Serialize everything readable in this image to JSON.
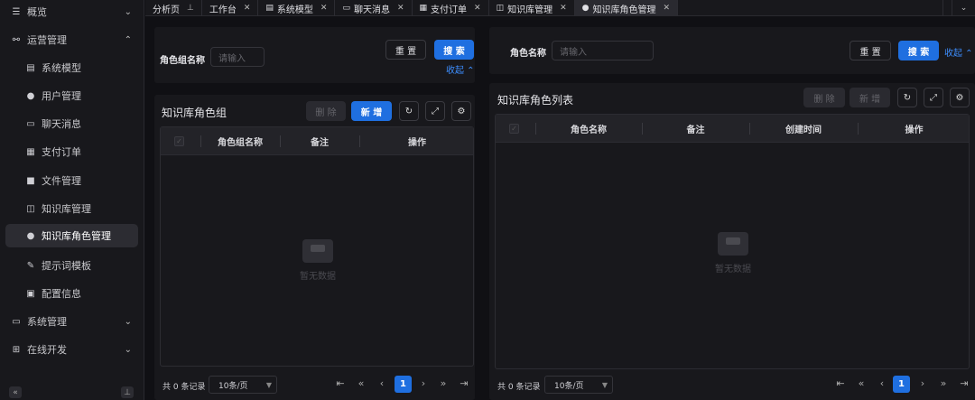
{
  "sidebar": {
    "items": [
      {
        "label": "概览",
        "icon": "menu-icon"
      },
      {
        "label": "运营管理",
        "icon": "operations-icon"
      },
      {
        "label": "系统模型",
        "icon": "list-icon"
      },
      {
        "label": "用户管理",
        "icon": "user-icon"
      },
      {
        "label": "聊天消息",
        "icon": "chat-icon"
      },
      {
        "label": "支付订单",
        "icon": "payment-icon"
      },
      {
        "label": "文件管理",
        "icon": "folder-icon"
      },
      {
        "label": "知识库管理",
        "icon": "book-icon"
      },
      {
        "label": "知识库角色管理",
        "icon": "user-icon"
      },
      {
        "label": "提示词模板",
        "icon": "template-icon"
      },
      {
        "label": "配置信息",
        "icon": "config-icon"
      },
      {
        "label": "系统管理",
        "icon": "monitor-icon"
      },
      {
        "label": "在线开发",
        "icon": "dev-icon"
      }
    ],
    "active_item": "知识库角色管理"
  },
  "tabs": [
    {
      "label": "分析页",
      "closable": false,
      "icon": "pin-icon"
    },
    {
      "label": "工作台",
      "closable": true
    },
    {
      "label": "系统模型",
      "closable": true,
      "icon": "list-icon"
    },
    {
      "label": "聊天消息",
      "closable": true,
      "icon": "chat-icon"
    },
    {
      "label": "支付订单",
      "closable": true,
      "icon": "payment-icon"
    },
    {
      "label": "知识库管理",
      "closable": true,
      "icon": "book-icon"
    },
    {
      "label": "知识库角色管理",
      "closable": true,
      "icon": "user-icon",
      "active": true
    }
  ],
  "left": {
    "search_label": "角色组名称",
    "search_placeholder": "请输入",
    "reset": "重 置",
    "search": "搜 索",
    "collapse": "收起",
    "title": "知识库角色组",
    "delete": "删 除",
    "add": "新 增",
    "columns": [
      "角色组名称",
      "备注",
      "操作"
    ],
    "empty_text": "暂无数据",
    "total": "共 0 条记录",
    "page_size": "10条/页",
    "current_page": "1"
  },
  "right": {
    "search_label": "角色名称",
    "search_placeholder": "请输入",
    "reset": "重 置",
    "search": "搜 索",
    "collapse": "收起",
    "title": "知识库角色列表",
    "delete": "删 除",
    "add": "新 增",
    "columns": [
      "角色名称",
      "备注",
      "创建时间",
      "操作"
    ],
    "empty_text": "暂无数据",
    "total": "共 0 条记录",
    "page_size": "10条/页",
    "current_page": "1"
  },
  "colors": {
    "primary": "#1f6fe0",
    "link": "#3d8eff",
    "background": "#101014",
    "panel": "#18181c"
  }
}
